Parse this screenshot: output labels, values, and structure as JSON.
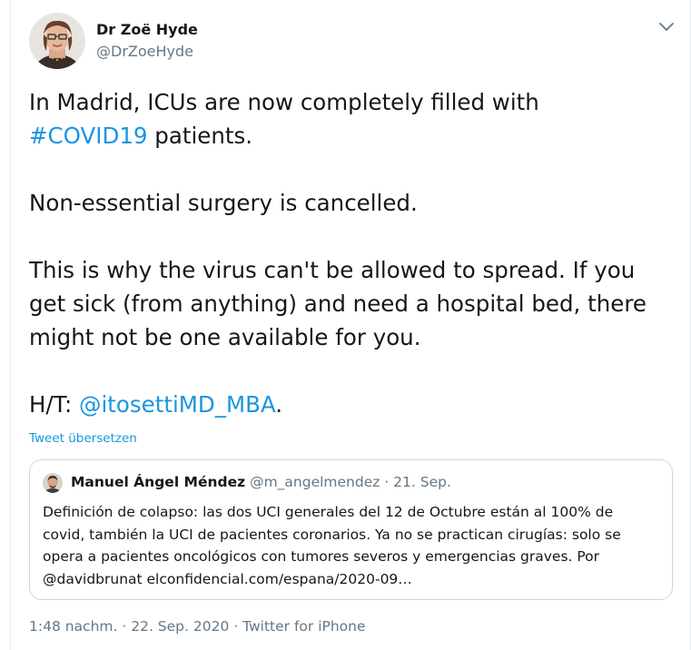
{
  "author": {
    "name": "Dr Zoë Hyde",
    "handle": "@DrZoeHyde"
  },
  "tweet": {
    "line1_pre": "In Madrid, ICUs are now completely filled with",
    "hashtag": "#COVID19",
    "line1_post": " patients.",
    "paragraph2": "Non-essential surgery is cancelled.",
    "paragraph3_line1": "This is why the virus can't be allowed to spread. If you",
    "paragraph3_line2": "get sick (from anything) and need a hospital bed, there",
    "paragraph3_line3": "might not be one available for you.",
    "ht_prefix": "H/T: ",
    "ht_mention": "@itosettiMD_MBA",
    "ht_suffix": "."
  },
  "translate_label": "Tweet übersetzen",
  "quote": {
    "name": "Manuel Ángel Méndez",
    "handle": "@m_angelmendez",
    "separator": " · ",
    "date": "21. Sep.",
    "line1": "Definición de colapso: las dos UCI generales del 12 de Octubre están al 100% de",
    "line2": "covid, también la UCI de pacientes coronarios. Ya no se practican cirugías: solo se",
    "line3": "opera a pacientes oncológicos con tumores severos y emergencias graves. Por",
    "line4": "@davidbrunat elconfidencial.com/espana/2020-09…"
  },
  "footer": {
    "time": "1:48 nachm.",
    "sep1": " · ",
    "date": "22. Sep. 2020",
    "sep2": " · ",
    "source": "Twitter for iPhone"
  },
  "colors": {
    "link": "#1b95e0",
    "secondary_text": "#657786",
    "primary_text": "#14171a",
    "border": "#ccd6dd"
  },
  "icons": {
    "caret": "chevron-down-icon"
  }
}
